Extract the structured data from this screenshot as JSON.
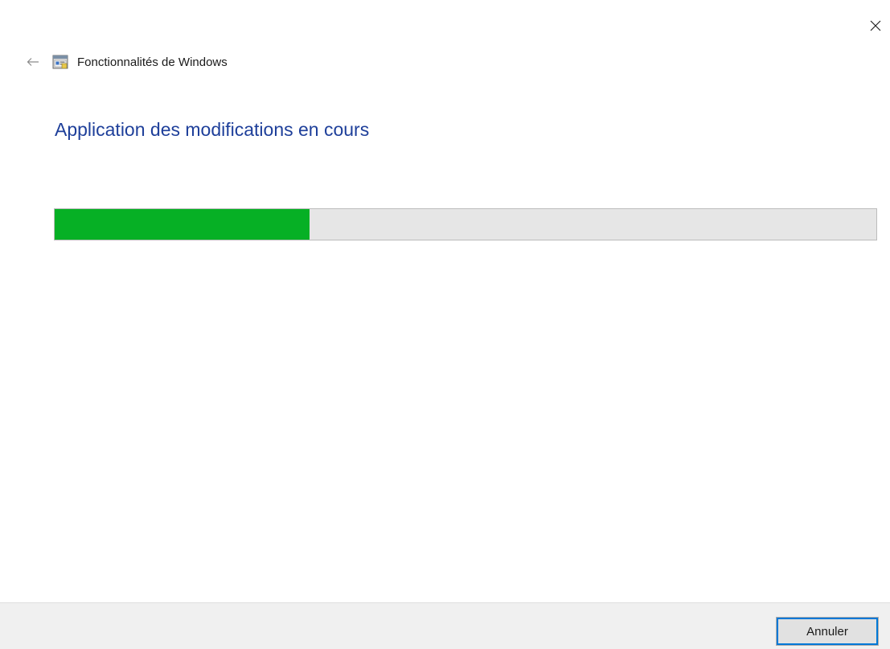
{
  "window": {
    "title": "Fonctionnalités de Windows",
    "app_icon": "windows-features-icon",
    "back_icon": "back-arrow-icon",
    "close_icon": "close-icon"
  },
  "main": {
    "heading": "Application des modifications en cours",
    "progress": {
      "fraction": 0.31,
      "fill_color": "#06b025",
      "track_color": "#e6e6e6"
    }
  },
  "footer": {
    "cancel_label": "Annuler"
  },
  "colors": {
    "heading": "#1e3f9a",
    "focus_outline": "#0078d7"
  }
}
